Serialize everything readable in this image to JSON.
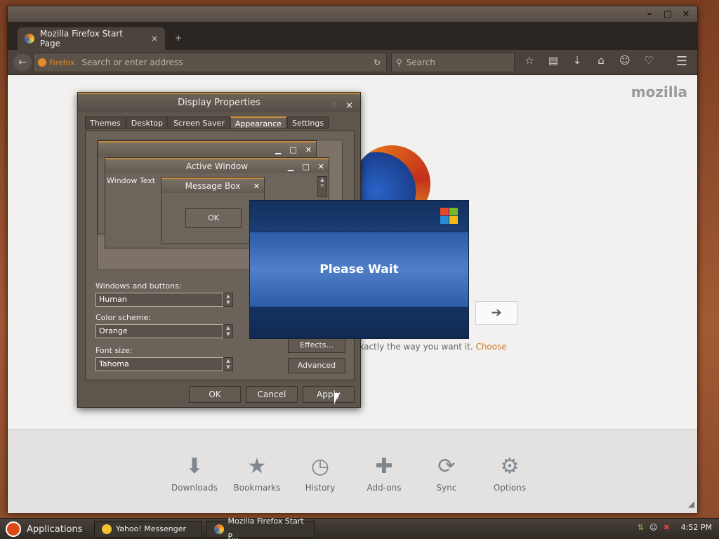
{
  "firefox": {
    "tab_title": "Mozilla Firefox Start Page",
    "tab_close": "×",
    "new_tab": "+",
    "url_brand": "Firefox",
    "url_placeholder": "Search or enter address",
    "search_placeholder": "Search",
    "mozilla": "mozilla",
    "snippet_text": "xactly the way you want it.",
    "snippet_link": "Choose",
    "launchers": [
      {
        "label": "Downloads",
        "icon": "download-icon"
      },
      {
        "label": "Bookmarks",
        "icon": "star-icon"
      },
      {
        "label": "History",
        "icon": "clock-icon"
      },
      {
        "label": "Add-ons",
        "icon": "puzzle-icon"
      },
      {
        "label": "Sync",
        "icon": "sync-icon"
      },
      {
        "label": "Options",
        "icon": "gear-icon"
      }
    ]
  },
  "dialog": {
    "title": "Display Properties",
    "help": "?",
    "close": "×",
    "tabs": [
      "Themes",
      "Desktop",
      "Screen Saver",
      "Appearance",
      "Settings"
    ],
    "active_tab": "Appearance",
    "preview": {
      "active_window": "Active Window",
      "window_text": "Window Text",
      "message_box": "Message Box",
      "ok": "OK"
    },
    "windows_buttons_label": "Windows and buttons:",
    "windows_buttons_value": "Human",
    "color_scheme_label": "Color scheme:",
    "color_scheme_value": "Orange",
    "font_size_label": "Font size:",
    "font_size_value": "Tahoma",
    "effects": "Effects...",
    "advanced": "Advanced",
    "ok": "OK",
    "cancel": "Cancel",
    "apply": "Apply"
  },
  "wait": {
    "text": "Please Wait"
  },
  "taskbar": {
    "applications": "Applications",
    "tasks": [
      "Yahoo! Messenger",
      "Mozilla Firefox Start P..."
    ],
    "time": "4:52 PM"
  }
}
